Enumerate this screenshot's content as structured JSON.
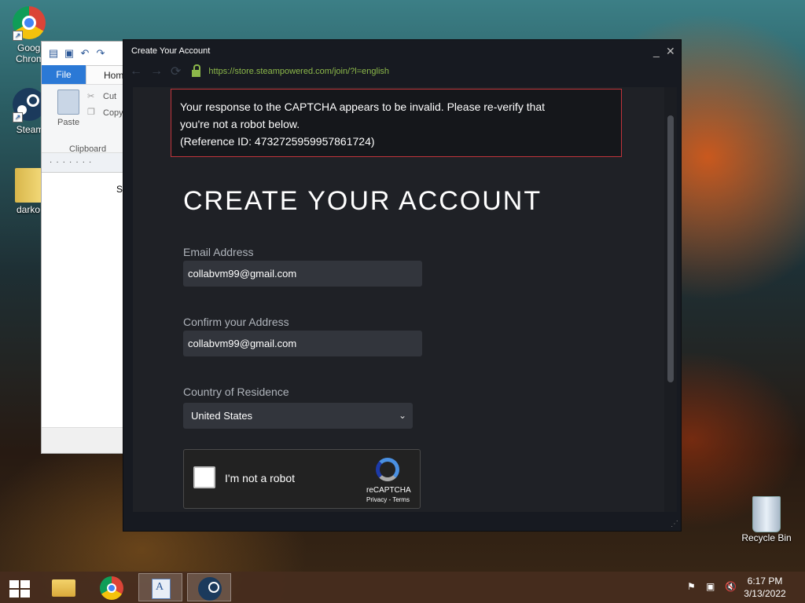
{
  "desktop": {
    "icons": [
      {
        "label": "Googl Chrom",
        "icon": "chrome-icon"
      },
      {
        "label": "Steam",
        "icon": "steam-icon"
      },
      {
        "label": "darko",
        "icon": "folder-icon"
      },
      {
        "label": "Recycle Bin",
        "icon": "recycle-bin-icon"
      }
    ]
  },
  "wordpad": {
    "tabs": {
      "file": "File",
      "home": "Hom"
    },
    "ribbon": {
      "paste": "Paste",
      "cut": "Cut",
      "copy": "Copy",
      "group": "Clipboard"
    },
    "doc_text": "S"
  },
  "steam_window": {
    "title": "Create Your Account",
    "url": "https://store.steampowered.com/join/?l=english",
    "error": {
      "line1": "Your response to the CAPTCHA appears to be invalid. Please re-verify that",
      "line2": "you're not a robot below.",
      "line3": "(Reference ID: 4732725959957861724)"
    },
    "heading": "CREATE YOUR ACCOUNT",
    "email_label": "Email Address",
    "email_value": "collabvm99@gmail.com",
    "confirm_label": "Confirm your Address",
    "confirm_value": "collabvm99@gmail.com",
    "country_label": "Country of Residence",
    "country_value": "United States",
    "captcha": {
      "label": "I'm not a robot",
      "brand": "reCAPTCHA",
      "links": "Privacy - Terms"
    }
  },
  "taskbar": {
    "time": "6:17 PM",
    "date": "3/13/2022"
  },
  "colors": {
    "steam_bg": "#1f2126",
    "error_border": "#c1343b",
    "url_green": "#8cb84a",
    "field_bg": "#32353c"
  }
}
